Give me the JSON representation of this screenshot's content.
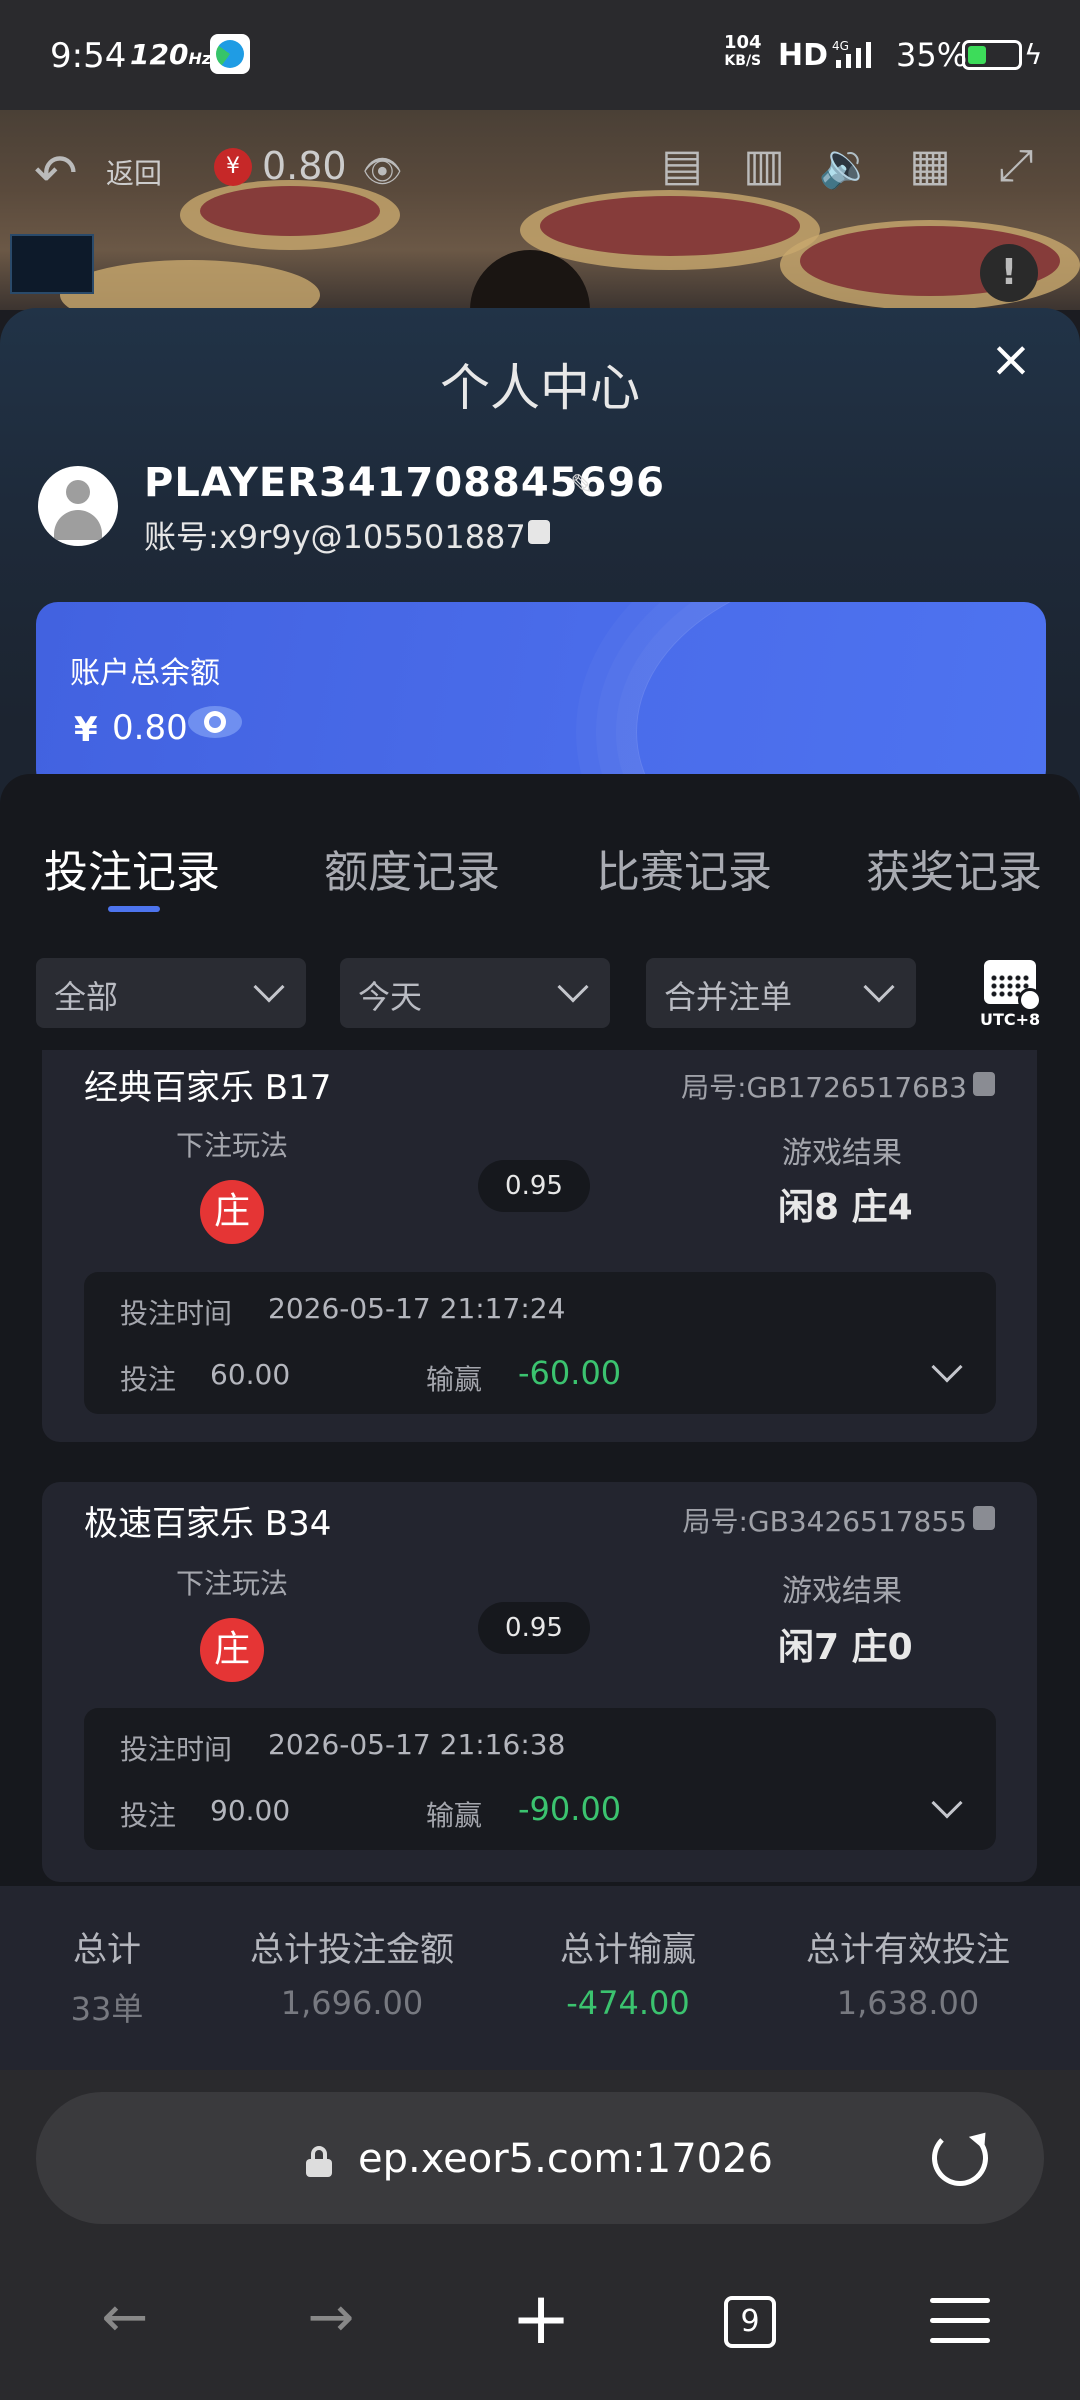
{
  "status_bar": {
    "time": "9:54",
    "refresh_rate": "120Hz",
    "net_speed_value": "104",
    "net_speed_unit": "KB/S",
    "hd": "HD",
    "network": "4G",
    "battery_percent": "35%"
  },
  "video_overlay": {
    "back_label": "返回",
    "balance": "0.80",
    "coin_symbol": "¥"
  },
  "panel": {
    "title": "个人中心",
    "player_name": "PLAYER341708845696",
    "account_label": "账号:x9r9y@105501887",
    "balance_card": {
      "label": "账户总余额",
      "currency": "¥",
      "value": "0.80"
    }
  },
  "tabs": [
    {
      "label": "投注记录",
      "active": true
    },
    {
      "label": "额度记录",
      "active": false
    },
    {
      "label": "比赛记录",
      "active": false
    },
    {
      "label": "获奖记录",
      "active": false
    }
  ],
  "filters": {
    "type": "全部",
    "date": "今天",
    "merge": "合并注单",
    "timezone": "UTC+8"
  },
  "records": [
    {
      "game": "经典百家乐 B17",
      "round": "局号:GB17265176B3",
      "bet_play_label": "下注玩法",
      "bet_play": "庄",
      "odds": "0.95",
      "result_label": "游戏结果",
      "result": "闲8 庄4",
      "time_label": "投注时间",
      "time": "2026-05-17 21:17:24",
      "bet_label": "投注",
      "bet_amount": "60.00",
      "winloss_label": "输赢",
      "winloss": "-60.00"
    },
    {
      "game": "极速百家乐 B34",
      "round": "局号:GB3426517855",
      "bet_play_label": "下注玩法",
      "bet_play": "庄",
      "odds": "0.95",
      "result_label": "游戏结果",
      "result": "闲7 庄0",
      "time_label": "投注时间",
      "time": "2026-05-17 21:16:38",
      "bet_label": "投注",
      "bet_amount": "90.00",
      "winloss_label": "输赢",
      "winloss": "-90.00"
    }
  ],
  "summary": {
    "total_label": "总计",
    "total_value": "33单",
    "bet_total_label": "总计投注金额",
    "bet_total_value": "1,696.00",
    "winloss_total_label": "总计输赢",
    "winloss_total_value": "-474.00",
    "valid_bet_label": "总计有效投注",
    "valid_bet_value": "1,638.00"
  },
  "browser": {
    "url": "ep.xeor5.com:17026",
    "tab_count": "9"
  },
  "colors": {
    "accent": "#4d74ee",
    "win_green": "#3bc36f",
    "banker_red": "#e53535"
  }
}
